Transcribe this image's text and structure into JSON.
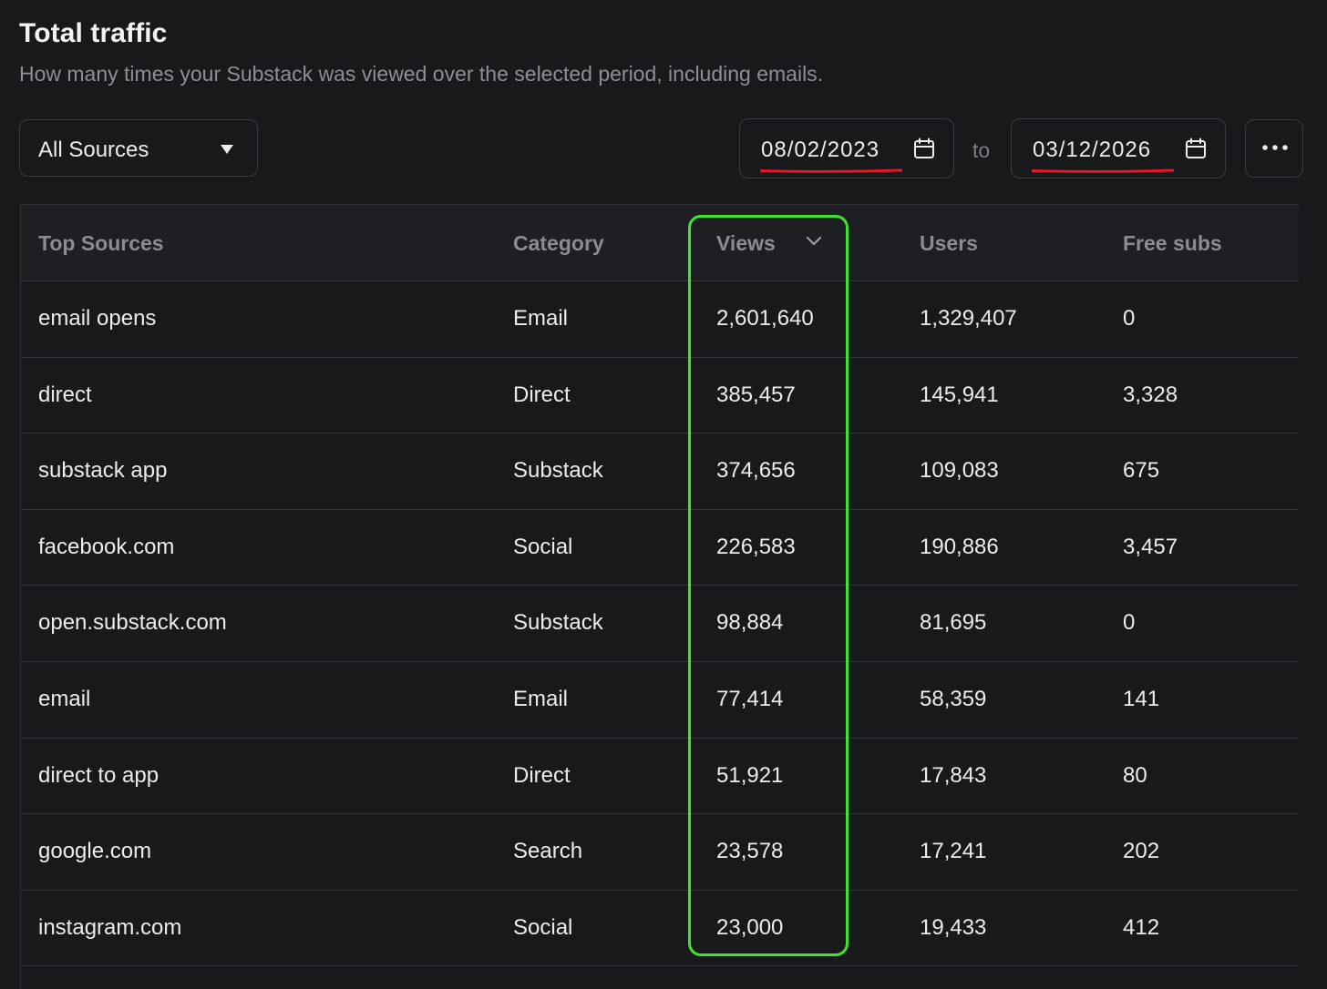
{
  "header": {
    "title": "Total traffic",
    "subtitle": "How many times your Substack was viewed over the selected period, including emails."
  },
  "filters": {
    "source": "All Sources",
    "date_from": "08/02/2023",
    "date_to": "03/12/2026",
    "to_label": "to"
  },
  "colors": {
    "highlight": "#3ee52e",
    "underline": "#e0192b",
    "background": "#18191b"
  },
  "table": {
    "columns": [
      "Top Sources",
      "Category",
      "Views",
      "Users",
      "Free subs"
    ],
    "sort_column": "Views",
    "rows": [
      [
        "email opens",
        "Email",
        "2,601,640",
        "1,329,407",
        "0"
      ],
      [
        "direct",
        "Direct",
        "385,457",
        "145,941",
        "3,328"
      ],
      [
        "substack app",
        "Substack",
        "374,656",
        "109,083",
        "675"
      ],
      [
        "facebook.com",
        "Social",
        "226,583",
        "190,886",
        "3,457"
      ],
      [
        "open.substack.com",
        "Substack",
        "98,884",
        "81,695",
        "0"
      ],
      [
        "email",
        "Email",
        "77,414",
        "58,359",
        "141"
      ],
      [
        "direct to app",
        "Direct",
        "51,921",
        "17,843",
        "80"
      ],
      [
        "google.com",
        "Search",
        "23,578",
        "17,241",
        "202"
      ],
      [
        "instagram.com",
        "Social",
        "23,000",
        "19,433",
        "412"
      ]
    ]
  }
}
